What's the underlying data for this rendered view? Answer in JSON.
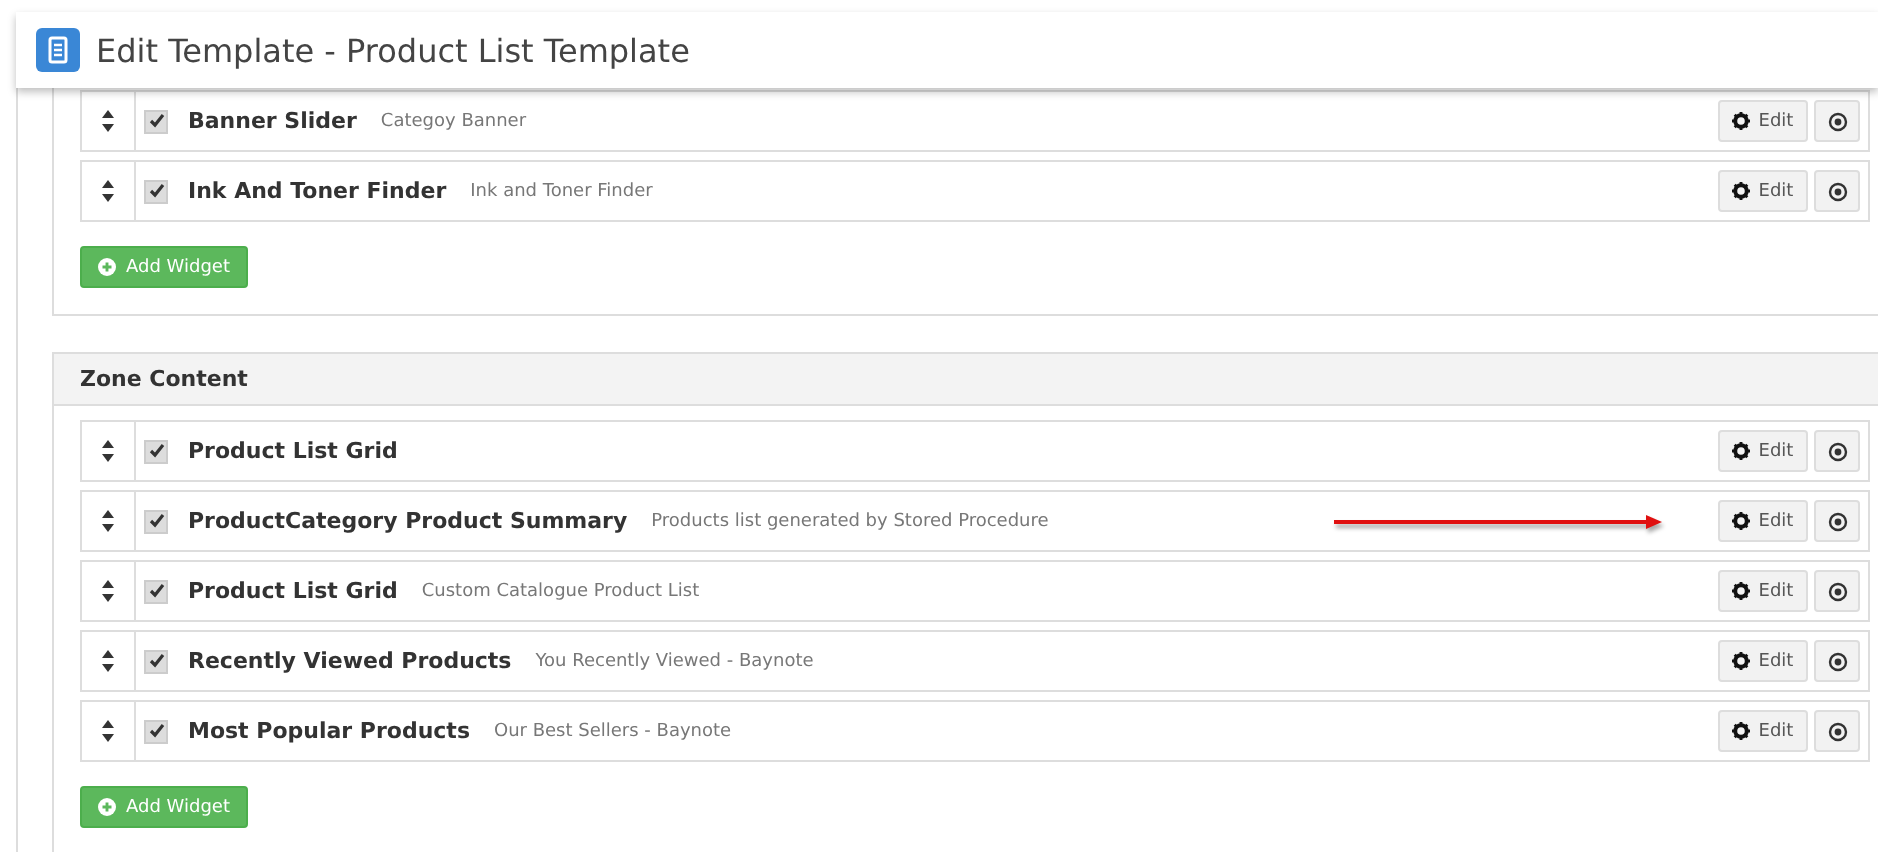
{
  "window": {
    "title": "Edit Template - Product List Template"
  },
  "zones": [
    {
      "add_button": "Add Widget",
      "widgets": [
        {
          "name": "Banner Slider",
          "description": "Categoy Banner",
          "checked": true,
          "edit": "Edit",
          "arrow": false
        },
        {
          "name": "Ink And Toner Finder",
          "description": "Ink and Toner Finder",
          "checked": true,
          "edit": "Edit",
          "arrow": false
        }
      ]
    },
    {
      "title": "Zone Content",
      "add_button": "Add Widget",
      "widgets": [
        {
          "name": "Product List Grid",
          "checked": true,
          "edit": "Edit",
          "arrow": false
        },
        {
          "name": "ProductCategory Product Summary",
          "description": "Products list generated by Stored Procedure",
          "checked": true,
          "edit": "Edit",
          "arrow": true
        },
        {
          "name": "Product List Grid",
          "description": "Custom Catalogue Product List",
          "checked": true,
          "edit": "Edit",
          "arrow": false
        },
        {
          "name": "Recently Viewed Products",
          "description": "You Recently Viewed - Baynote",
          "checked": true,
          "edit": "Edit",
          "arrow": false
        },
        {
          "name": "Most Popular Products",
          "description": "Our Best Sellers - Baynote",
          "checked": true,
          "edit": "Edit",
          "arrow": false
        }
      ]
    }
  ]
}
